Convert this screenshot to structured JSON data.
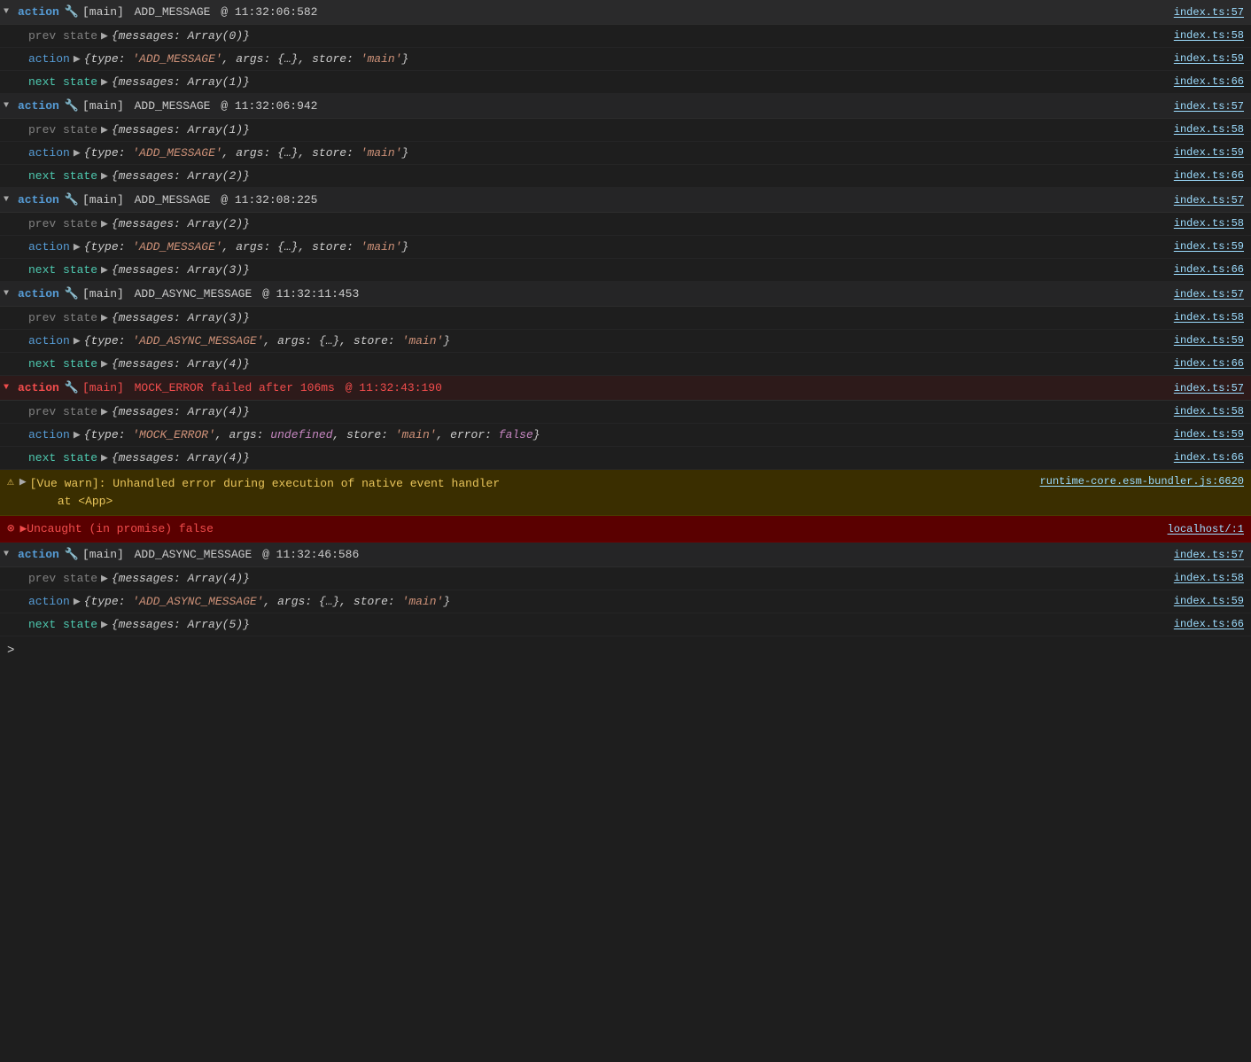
{
  "actions": [
    {
      "id": 1,
      "expanded": true,
      "keyword": "action",
      "store": "[main]",
      "name": "ADD_MESSAGE",
      "timestamp": "@ 11:32:06:582",
      "file": "index.ts:57",
      "is_error": false,
      "rows": [
        {
          "type": "prev",
          "label": "prev state",
          "content": "{messages: Array(0)}",
          "file": "index.ts:58"
        },
        {
          "type": "action",
          "label": "action",
          "content": "{type: 'ADD_MESSAGE', args: {…}, store: 'main'}",
          "file": "index.ts:59"
        },
        {
          "type": "next",
          "label": "next state",
          "content": "{messages: Array(1)}",
          "file": "index.ts:66"
        }
      ]
    },
    {
      "id": 2,
      "expanded": true,
      "keyword": "action",
      "store": "[main]",
      "name": "ADD_MESSAGE",
      "timestamp": "@ 11:32:06:942",
      "file": "index.ts:57",
      "is_error": false,
      "rows": [
        {
          "type": "prev",
          "label": "prev state",
          "content": "{messages: Array(1)}",
          "file": "index.ts:58"
        },
        {
          "type": "action",
          "label": "action",
          "content": "{type: 'ADD_MESSAGE', args: {…}, store: 'main'}",
          "file": "index.ts:59"
        },
        {
          "type": "next",
          "label": "next state",
          "content": "{messages: Array(2)}",
          "file": "index.ts:66"
        }
      ]
    },
    {
      "id": 3,
      "expanded": true,
      "keyword": "action",
      "store": "[main]",
      "name": "ADD_MESSAGE",
      "timestamp": "@ 11:32:08:225",
      "file": "index.ts:57",
      "is_error": false,
      "rows": [
        {
          "type": "prev",
          "label": "prev state",
          "content": "{messages: Array(2)}",
          "file": "index.ts:58"
        },
        {
          "type": "action",
          "label": "action",
          "content": "{type: 'ADD_MESSAGE', args: {…}, store: 'main'}",
          "file": "index.ts:59"
        },
        {
          "type": "next",
          "label": "next state",
          "content": "{messages: Array(3)}",
          "file": "index.ts:66"
        }
      ]
    },
    {
      "id": 4,
      "expanded": true,
      "keyword": "action",
      "store": "[main]",
      "name": "ADD_ASYNC_MESSAGE",
      "timestamp": "@ 11:32:11:453",
      "file": "index.ts:57",
      "is_error": false,
      "rows": [
        {
          "type": "prev",
          "label": "prev state",
          "content": "{messages: Array(3)}",
          "file": "index.ts:58"
        },
        {
          "type": "action",
          "label": "action",
          "content": "{type: 'ADD_ASYNC_MESSAGE', args: {…}, store: 'main'}",
          "file": "index.ts:59"
        },
        {
          "type": "next",
          "label": "next state",
          "content": "{messages: Array(4)}",
          "file": "index.ts:66"
        }
      ]
    },
    {
      "id": 5,
      "expanded": true,
      "keyword": "action",
      "store": "[main]",
      "name": "MOCK_ERROR failed after 106ms",
      "timestamp": "@ 11:32:43:190",
      "file": "index.ts:57",
      "is_error": true,
      "rows": [
        {
          "type": "prev",
          "label": "prev state",
          "content": "{messages: Array(4)}",
          "file": "index.ts:58"
        },
        {
          "type": "action",
          "label": "action",
          "content": "{type: 'MOCK_ERROR', args: undefined, store: 'main', error: false}",
          "file": "index.ts:59"
        },
        {
          "type": "next",
          "label": "next state",
          "content": "{messages: Array(4)}",
          "file": "index.ts:66"
        }
      ]
    }
  ],
  "warning": {
    "icon": "⚠",
    "text": "[Vue warn]: Unhandled error during execution of native event handler\n    at <App>",
    "file": "runtime-core.esm-bundler.js:6620"
  },
  "error": {
    "icon": "✖",
    "text": "▶Uncaught (in promise) false",
    "file": "localhost/:1"
  },
  "last_action": {
    "expanded": true,
    "keyword": "action",
    "store": "[main]",
    "name": "ADD_ASYNC_MESSAGE",
    "timestamp": "@ 11:32:46:586",
    "file": "index.ts:57",
    "rows": [
      {
        "type": "prev",
        "label": "prev state",
        "content": "{messages: Array(4)}",
        "file": "index.ts:58"
      },
      {
        "type": "action",
        "label": "action",
        "content": "{type: 'ADD_ASYNC_MESSAGE', args: {…}, store: 'main'}",
        "file": "index.ts:59"
      },
      {
        "type": "next",
        "label": "next state",
        "content": "{messages: Array(5)}",
        "file": "index.ts:66"
      }
    ]
  },
  "prompt": ">"
}
